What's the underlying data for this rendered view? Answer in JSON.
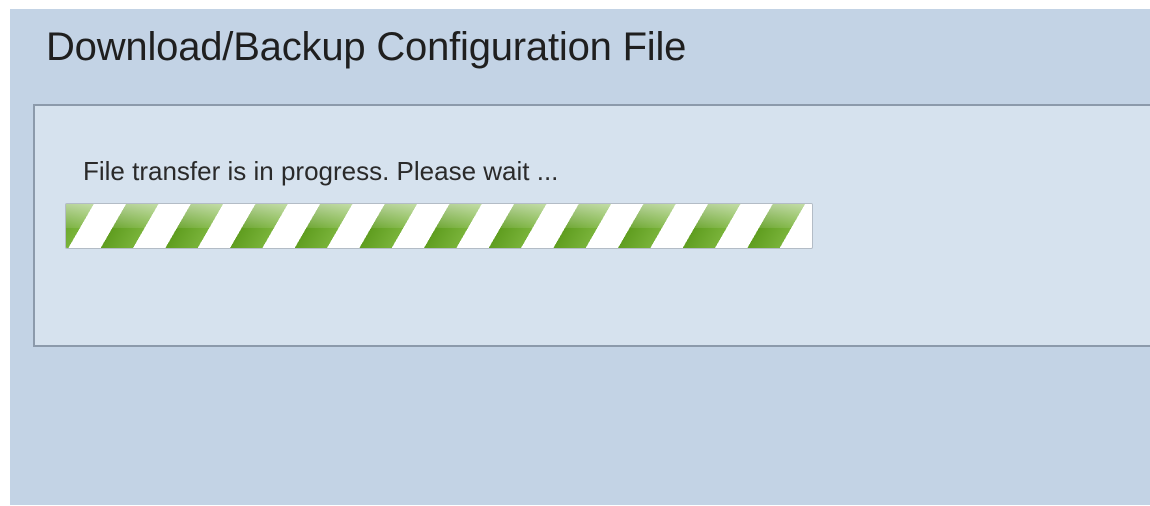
{
  "page": {
    "title": "Download/Backup Configuration File"
  },
  "transfer": {
    "status_message": "File transfer is in progress. Please wait ...",
    "progress_fraction": 1.0
  },
  "colors": {
    "page_background": "#c3d3e5",
    "panel_background": "#d6e2ee",
    "panel_border": "#8c9aab",
    "progress_green": "#5f9d1f",
    "progress_stripe_light": "#ffffff"
  }
}
